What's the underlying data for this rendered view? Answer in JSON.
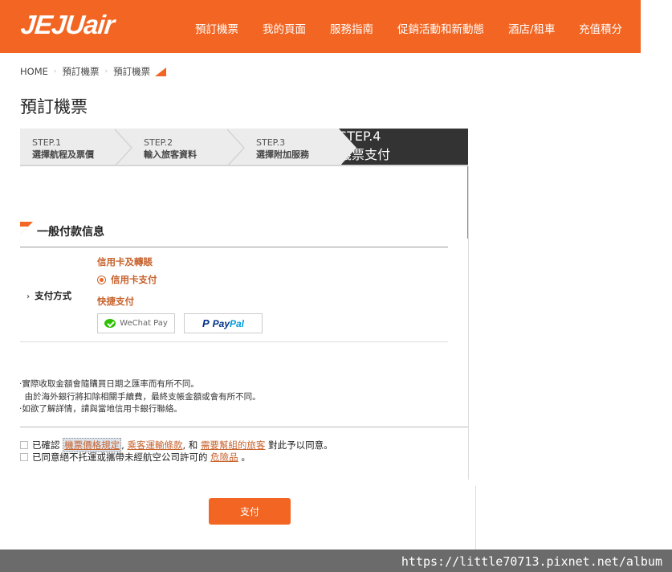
{
  "header": {
    "logo": "JEJUair",
    "nav": [
      "預訂機票",
      "我的頁面",
      "服務指南",
      "促銷活動和新動態",
      "酒店/租車",
      "充值積分"
    ]
  },
  "breadcrumb": [
    "HOME",
    "預訂機票",
    "預訂機票"
  ],
  "page_title": "預訂機票",
  "steps": [
    {
      "num": "STEP.1",
      "label": "選擇航程及票價"
    },
    {
      "num": "STEP.2",
      "label": "輸入旅客資料"
    },
    {
      "num": "STEP.3",
      "label": "選擇附加服務"
    },
    {
      "num": "STEP.4",
      "label": "機票支付"
    }
  ],
  "payment": {
    "section_title": "一般付款信息",
    "method_label": "支付方式",
    "cc_heading": "信用卡及轉賬",
    "cc_option": "信用卡支付",
    "quick_heading": "快捷支付",
    "wechat_label": "WeChat Pay",
    "paypal_pay": "Pay",
    "paypal_pal": "Pal"
  },
  "notes": [
    "·實際收取金額會隨購買日期之匯率而有所不同。",
    "  由於海外銀行將扣除相關手續費，最終支帳金額或會有所不同。",
    "·如欲了解詳情，請與當地信用卡銀行聯絡。"
  ],
  "agreements": {
    "line1_prefix": "已確認",
    "link_fare": "機票價格規定",
    "comma1": ",",
    "link_carriage": "乘客運輸條款",
    "and": ", 和",
    "link_assist": "需要幫組的旅客",
    "line1_suffix": "對此予以同意。",
    "line2_prefix": "已同意絕不托運或攜帶未經航空公司許可的",
    "link_danger": "危險品",
    "line2_suffix": "。"
  },
  "submit_label": "支付",
  "watermark": "https://little70713.pixnet.net/album",
  "colors": {
    "brand": "#f26522",
    "link": "#c7622d",
    "active_step": "#333333"
  }
}
